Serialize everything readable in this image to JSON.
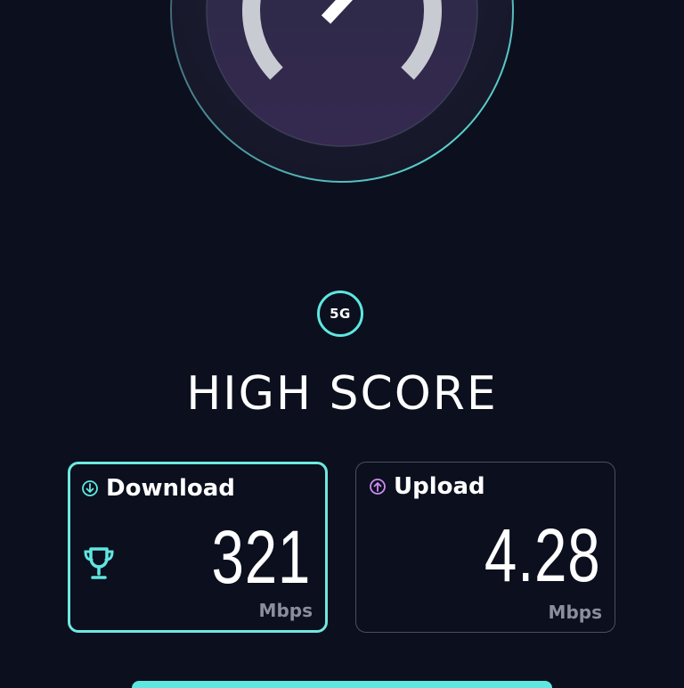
{
  "gauge": {
    "icon": "speedometer-gauge-icon"
  },
  "network": {
    "badge_label": "5G"
  },
  "result": {
    "headline": "HIGH SCORE"
  },
  "download": {
    "label": "Download",
    "value": "321",
    "unit": "Mbps",
    "icon": "arrow-down-circle-icon",
    "badge_icon": "trophy-icon"
  },
  "upload": {
    "label": "Upload",
    "value": "4.28",
    "unit": "Mbps",
    "icon": "arrow-up-circle-icon"
  },
  "colors": {
    "background": "#0b0f1e",
    "accent": "#5ee7e0",
    "upload_icon": "#c98cf0",
    "muted_text": "#8b8e9b"
  }
}
